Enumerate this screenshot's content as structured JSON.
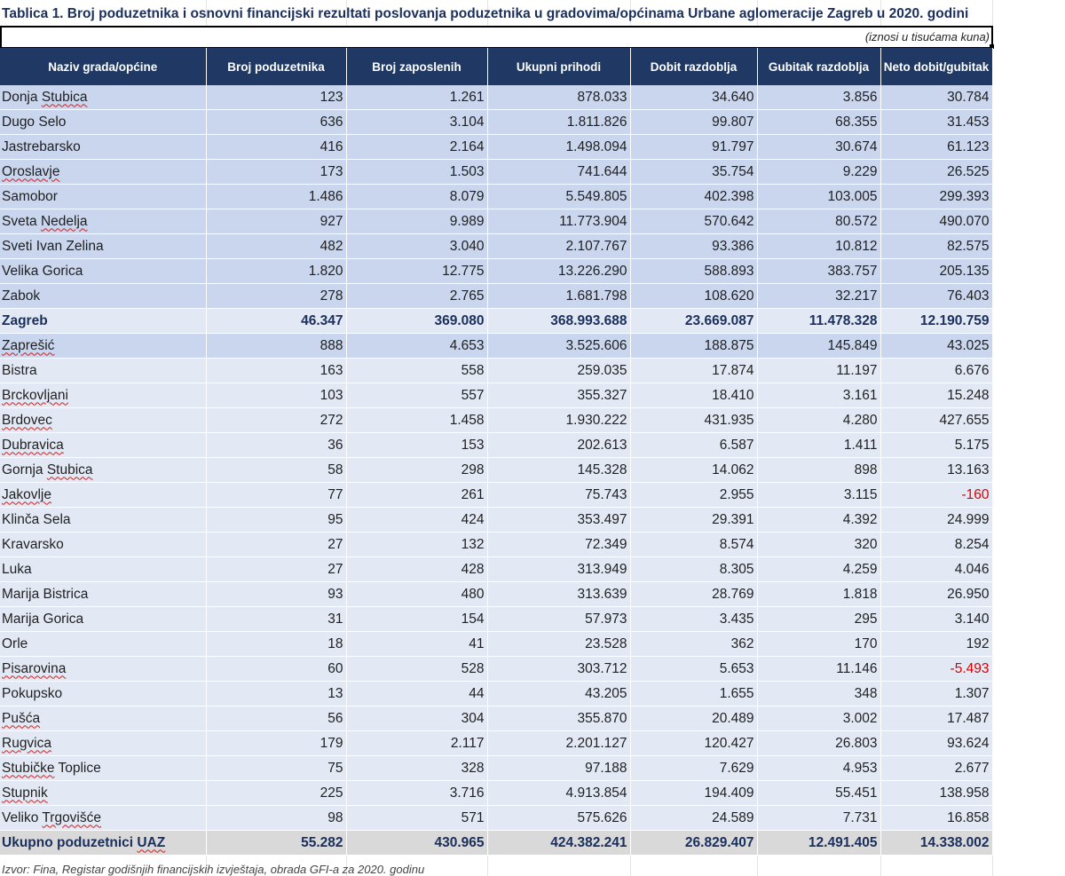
{
  "title": "Tablica 1. Broj poduzetnika i osnovni financijski rezultati poslovanja poduzetnika u gradovima/općinama Urbane aglomeracije Zagreb u 2020. godini",
  "units_note": "(iznosi u tisućama kuna)",
  "columns": [
    "Naziv grada/općine",
    "Broj poduzetnika",
    "Broj zaposlenih",
    "Ukupni prihodi",
    "Dobit razdoblja",
    "Gubitak razdoblja",
    "Neto dobit/gubitak"
  ],
  "rows": [
    {
      "name": "Donja Stubica",
      "values": [
        "123",
        "1.261",
        "878.033",
        "34.640",
        "3.856",
        "30.784"
      ],
      "group": "a",
      "squiggle": "Stubica"
    },
    {
      "name": "Dugo Selo",
      "values": [
        "636",
        "3.104",
        "1.811.826",
        "99.807",
        "68.355",
        "31.453"
      ],
      "group": "a"
    },
    {
      "name": "Jastrebarsko",
      "values": [
        "416",
        "2.164",
        "1.498.094",
        "91.797",
        "30.674",
        "61.123"
      ],
      "group": "a"
    },
    {
      "name": "Oroslavje",
      "values": [
        "173",
        "1.503",
        "741.644",
        "35.754",
        "9.229",
        "26.525"
      ],
      "group": "a",
      "squiggle": "Oroslavje"
    },
    {
      "name": "Samobor",
      "values": [
        "1.486",
        "8.079",
        "5.549.805",
        "402.398",
        "103.005",
        "299.393"
      ],
      "group": "a"
    },
    {
      "name": "Sveta Nedelja",
      "values": [
        "927",
        "9.989",
        "11.773.904",
        "570.642",
        "80.572",
        "490.070"
      ],
      "group": "a",
      "squiggle": "Nedelja"
    },
    {
      "name": "Sveti Ivan Zelina",
      "values": [
        "482",
        "3.040",
        "2.107.767",
        "93.386",
        "10.812",
        "82.575"
      ],
      "group": "a"
    },
    {
      "name": "Velika Gorica",
      "values": [
        "1.820",
        "12.775",
        "13.226.290",
        "588.893",
        "383.757",
        "205.135"
      ],
      "group": "a"
    },
    {
      "name": "Zabok",
      "values": [
        "278",
        "2.765",
        "1.681.798",
        "108.620",
        "32.217",
        "76.403"
      ],
      "group": "a"
    },
    {
      "name": "Zagreb",
      "values": [
        "46.347",
        "369.080",
        "368.993.688",
        "23.669.087",
        "11.478.328",
        "12.190.759"
      ],
      "group": "b",
      "highlight": true
    },
    {
      "name": "Zaprešić",
      "values": [
        "888",
        "4.653",
        "3.525.606",
        "188.875",
        "145.849",
        "43.025"
      ],
      "group": "a",
      "squiggle": "Zaprešić"
    },
    {
      "name": "Bistra",
      "values": [
        "163",
        "558",
        "259.035",
        "17.874",
        "11.197",
        "6.676"
      ],
      "group": "b"
    },
    {
      "name": "Brckovljani",
      "values": [
        "103",
        "557",
        "355.327",
        "18.410",
        "3.161",
        "15.248"
      ],
      "group": "b",
      "squiggle": "Brckovljani"
    },
    {
      "name": "Brdovec",
      "values": [
        "272",
        "1.458",
        "1.930.222",
        "431.935",
        "4.280",
        "427.655"
      ],
      "group": "b",
      "squiggle": "Brdovec"
    },
    {
      "name": "Dubravica",
      "values": [
        "36",
        "153",
        "202.613",
        "6.587",
        "1.411",
        "5.175"
      ],
      "group": "b",
      "squiggle": "Dubravica"
    },
    {
      "name": "Gornja Stubica",
      "values": [
        "58",
        "298",
        "145.328",
        "14.062",
        "898",
        "13.163"
      ],
      "group": "b",
      "squiggle": "Stubica"
    },
    {
      "name": "Jakovlje",
      "values": [
        "77",
        "261",
        "75.743",
        "2.955",
        "3.115",
        "-160"
      ],
      "group": "b",
      "squiggle": "Jakovlje"
    },
    {
      "name": "Klinča Sela",
      "values": [
        "95",
        "424",
        "353.497",
        "29.391",
        "4.392",
        "24.999"
      ],
      "group": "b"
    },
    {
      "name": "Kravarsko",
      "values": [
        "27",
        "132",
        "72.349",
        "8.574",
        "320",
        "8.254"
      ],
      "group": "b"
    },
    {
      "name": "Luka",
      "values": [
        "27",
        "428",
        "313.949",
        "8.305",
        "4.259",
        "4.046"
      ],
      "group": "b"
    },
    {
      "name": "Marija Bistrica",
      "values": [
        "93",
        "480",
        "313.639",
        "28.769",
        "1.818",
        "26.950"
      ],
      "group": "b"
    },
    {
      "name": "Marija Gorica",
      "values": [
        "31",
        "154",
        "57.973",
        "3.435",
        "295",
        "3.140"
      ],
      "group": "b"
    },
    {
      "name": "Orle",
      "values": [
        "18",
        "41",
        "23.528",
        "362",
        "170",
        "192"
      ],
      "group": "b"
    },
    {
      "name": "Pisarovina",
      "values": [
        "60",
        "528",
        "303.712",
        "5.653",
        "11.146",
        "-5.493"
      ],
      "group": "b",
      "squiggle": "Pisarovina"
    },
    {
      "name": "Pokupsko",
      "values": [
        "13",
        "44",
        "43.205",
        "1.655",
        "348",
        "1.307"
      ],
      "group": "b"
    },
    {
      "name": "Pušća",
      "values": [
        "56",
        "304",
        "355.870",
        "20.489",
        "3.002",
        "17.487"
      ],
      "group": "b",
      "squiggle": "Pušća"
    },
    {
      "name": "Rugvica",
      "values": [
        "179",
        "2.117",
        "2.201.127",
        "120.427",
        "26.803",
        "93.624"
      ],
      "group": "b",
      "squiggle": "Rugvica"
    },
    {
      "name": "Stubičke Toplice",
      "values": [
        "75",
        "328",
        "97.188",
        "7.629",
        "4.953",
        "2.677"
      ],
      "group": "b",
      "squiggle": "Stubičke"
    },
    {
      "name": "Stupnik",
      "values": [
        "225",
        "3.716",
        "4.913.854",
        "194.409",
        "55.451",
        "138.958"
      ],
      "group": "b",
      "squiggle": "Stupnik"
    },
    {
      "name": "Veliko Trgovišće",
      "values": [
        "98",
        "571",
        "575.626",
        "24.589",
        "7.731",
        "16.858"
      ],
      "group": "b",
      "squiggle": "Trgovišće"
    }
  ],
  "total": {
    "name": "Ukupno poduzetnici UAZ",
    "values": [
      "55.282",
      "430.965",
      "424.382.241",
      "26.829.407",
      "12.491.405",
      "14.338.002"
    ],
    "squiggle": "UAZ"
  },
  "source": "Izvor: Fina, Registar godišnjih financijskih izvještaja, obrada GFI-a za 2020. godinu",
  "colors": {
    "header_bg": "#1f3864",
    "row_blue": "#c9d6ee",
    "row_light": "#e3e9f4",
    "total_bg": "#d9d9d9",
    "negative": "#e00000"
  }
}
